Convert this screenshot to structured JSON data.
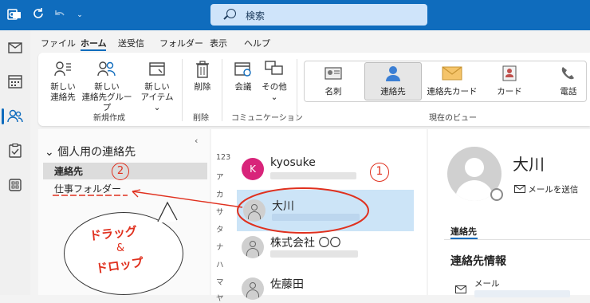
{
  "titlebar": {
    "search_placeholder": "検索",
    "icons": [
      "outlook-logo-icon",
      "sync-icon",
      "undo-icon",
      "customize-qat-icon"
    ]
  },
  "rail": [
    "mail-icon",
    "calendar-icon",
    "people-icon",
    "tasks-icon",
    "apps-icon"
  ],
  "tabs": [
    "ファイル",
    "ホーム",
    "送受信",
    "フォルダー",
    "表示",
    "ヘルプ"
  ],
  "ribbon": {
    "new_contact": "新しい\n連絡先",
    "new_group": "新しい\n連絡先グループ",
    "new_items": "新しい\nアイテム ⌄",
    "group_new": "新規作成",
    "delete": "削除",
    "group_delete": "削除",
    "meeting": "会議",
    "more": "その他\n⌄",
    "group_comm": "コミュニケーション",
    "views": [
      "名刺",
      "連絡先",
      "連絡先カード",
      "カード",
      "電話"
    ],
    "group_view": "現在のビュー"
  },
  "nav": {
    "header": "個人用の連絡先",
    "items": [
      "連絡先",
      "仕事フォルダー"
    ]
  },
  "alphabet": [
    "123",
    "ア",
    "カ",
    "サ",
    "タ",
    "ナ",
    "ハ",
    "マ",
    "ヤ"
  ],
  "contacts": [
    {
      "name": "kyosuke",
      "initial": "K"
    },
    {
      "name": "大川",
      "initial": ""
    },
    {
      "name": "株式会社 〇〇",
      "initial": ""
    },
    {
      "name": "佐藤田",
      "initial": ""
    }
  ],
  "reading": {
    "name": "大川",
    "send_mail": "メールを送信",
    "tab": "連絡先",
    "section": "連絡先情報",
    "mail_label": "メール"
  },
  "annotations": {
    "num1": "1",
    "num2": "2",
    "drag": "ドラッグ",
    "amp": "&",
    "drop": "ドロップ"
  }
}
